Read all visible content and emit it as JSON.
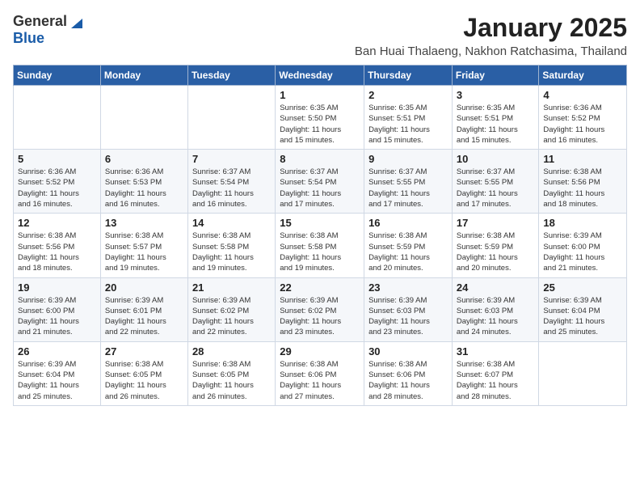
{
  "header": {
    "logo_general": "General",
    "logo_blue": "Blue",
    "month_year": "January 2025",
    "location": "Ban Huai Thalaeng, Nakhon Ratchasima, Thailand"
  },
  "days_of_week": [
    "Sunday",
    "Monday",
    "Tuesday",
    "Wednesday",
    "Thursday",
    "Friday",
    "Saturday"
  ],
  "weeks": [
    [
      {
        "day": "",
        "info": ""
      },
      {
        "day": "",
        "info": ""
      },
      {
        "day": "",
        "info": ""
      },
      {
        "day": "1",
        "info": "Sunrise: 6:35 AM\nSunset: 5:50 PM\nDaylight: 11 hours\nand 15 minutes."
      },
      {
        "day": "2",
        "info": "Sunrise: 6:35 AM\nSunset: 5:51 PM\nDaylight: 11 hours\nand 15 minutes."
      },
      {
        "day": "3",
        "info": "Sunrise: 6:35 AM\nSunset: 5:51 PM\nDaylight: 11 hours\nand 15 minutes."
      },
      {
        "day": "4",
        "info": "Sunrise: 6:36 AM\nSunset: 5:52 PM\nDaylight: 11 hours\nand 16 minutes."
      }
    ],
    [
      {
        "day": "5",
        "info": "Sunrise: 6:36 AM\nSunset: 5:52 PM\nDaylight: 11 hours\nand 16 minutes."
      },
      {
        "day": "6",
        "info": "Sunrise: 6:36 AM\nSunset: 5:53 PM\nDaylight: 11 hours\nand 16 minutes."
      },
      {
        "day": "7",
        "info": "Sunrise: 6:37 AM\nSunset: 5:54 PM\nDaylight: 11 hours\nand 16 minutes."
      },
      {
        "day": "8",
        "info": "Sunrise: 6:37 AM\nSunset: 5:54 PM\nDaylight: 11 hours\nand 17 minutes."
      },
      {
        "day": "9",
        "info": "Sunrise: 6:37 AM\nSunset: 5:55 PM\nDaylight: 11 hours\nand 17 minutes."
      },
      {
        "day": "10",
        "info": "Sunrise: 6:37 AM\nSunset: 5:55 PM\nDaylight: 11 hours\nand 17 minutes."
      },
      {
        "day": "11",
        "info": "Sunrise: 6:38 AM\nSunset: 5:56 PM\nDaylight: 11 hours\nand 18 minutes."
      }
    ],
    [
      {
        "day": "12",
        "info": "Sunrise: 6:38 AM\nSunset: 5:56 PM\nDaylight: 11 hours\nand 18 minutes."
      },
      {
        "day": "13",
        "info": "Sunrise: 6:38 AM\nSunset: 5:57 PM\nDaylight: 11 hours\nand 19 minutes."
      },
      {
        "day": "14",
        "info": "Sunrise: 6:38 AM\nSunset: 5:58 PM\nDaylight: 11 hours\nand 19 minutes."
      },
      {
        "day": "15",
        "info": "Sunrise: 6:38 AM\nSunset: 5:58 PM\nDaylight: 11 hours\nand 19 minutes."
      },
      {
        "day": "16",
        "info": "Sunrise: 6:38 AM\nSunset: 5:59 PM\nDaylight: 11 hours\nand 20 minutes."
      },
      {
        "day": "17",
        "info": "Sunrise: 6:38 AM\nSunset: 5:59 PM\nDaylight: 11 hours\nand 20 minutes."
      },
      {
        "day": "18",
        "info": "Sunrise: 6:39 AM\nSunset: 6:00 PM\nDaylight: 11 hours\nand 21 minutes."
      }
    ],
    [
      {
        "day": "19",
        "info": "Sunrise: 6:39 AM\nSunset: 6:00 PM\nDaylight: 11 hours\nand 21 minutes."
      },
      {
        "day": "20",
        "info": "Sunrise: 6:39 AM\nSunset: 6:01 PM\nDaylight: 11 hours\nand 22 minutes."
      },
      {
        "day": "21",
        "info": "Sunrise: 6:39 AM\nSunset: 6:02 PM\nDaylight: 11 hours\nand 22 minutes."
      },
      {
        "day": "22",
        "info": "Sunrise: 6:39 AM\nSunset: 6:02 PM\nDaylight: 11 hours\nand 23 minutes."
      },
      {
        "day": "23",
        "info": "Sunrise: 6:39 AM\nSunset: 6:03 PM\nDaylight: 11 hours\nand 23 minutes."
      },
      {
        "day": "24",
        "info": "Sunrise: 6:39 AM\nSunset: 6:03 PM\nDaylight: 11 hours\nand 24 minutes."
      },
      {
        "day": "25",
        "info": "Sunrise: 6:39 AM\nSunset: 6:04 PM\nDaylight: 11 hours\nand 25 minutes."
      }
    ],
    [
      {
        "day": "26",
        "info": "Sunrise: 6:39 AM\nSunset: 6:04 PM\nDaylight: 11 hours\nand 25 minutes."
      },
      {
        "day": "27",
        "info": "Sunrise: 6:38 AM\nSunset: 6:05 PM\nDaylight: 11 hours\nand 26 minutes."
      },
      {
        "day": "28",
        "info": "Sunrise: 6:38 AM\nSunset: 6:05 PM\nDaylight: 11 hours\nand 26 minutes."
      },
      {
        "day": "29",
        "info": "Sunrise: 6:38 AM\nSunset: 6:06 PM\nDaylight: 11 hours\nand 27 minutes."
      },
      {
        "day": "30",
        "info": "Sunrise: 6:38 AM\nSunset: 6:06 PM\nDaylight: 11 hours\nand 28 minutes."
      },
      {
        "day": "31",
        "info": "Sunrise: 6:38 AM\nSunset: 6:07 PM\nDaylight: 11 hours\nand 28 minutes."
      },
      {
        "day": "",
        "info": ""
      }
    ]
  ]
}
